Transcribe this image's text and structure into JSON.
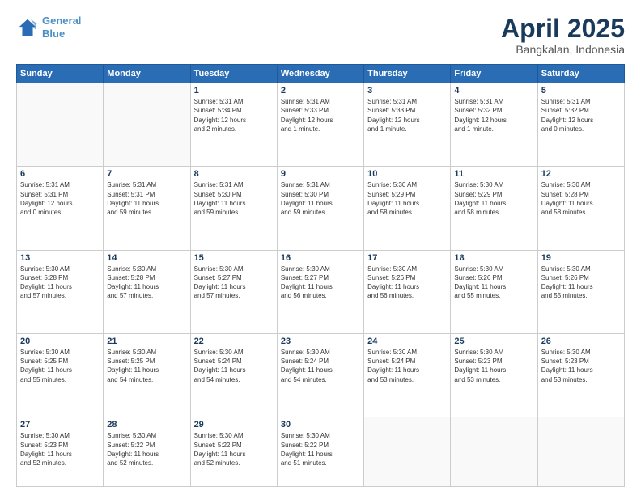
{
  "header": {
    "logo_line1": "General",
    "logo_line2": "Blue",
    "month": "April 2025",
    "location": "Bangkalan, Indonesia"
  },
  "weekdays": [
    "Sunday",
    "Monday",
    "Tuesday",
    "Wednesday",
    "Thursday",
    "Friday",
    "Saturday"
  ],
  "weeks": [
    [
      {
        "day": "",
        "info": ""
      },
      {
        "day": "",
        "info": ""
      },
      {
        "day": "1",
        "info": "Sunrise: 5:31 AM\nSunset: 5:34 PM\nDaylight: 12 hours\nand 2 minutes."
      },
      {
        "day": "2",
        "info": "Sunrise: 5:31 AM\nSunset: 5:33 PM\nDaylight: 12 hours\nand 1 minute."
      },
      {
        "day": "3",
        "info": "Sunrise: 5:31 AM\nSunset: 5:33 PM\nDaylight: 12 hours\nand 1 minute."
      },
      {
        "day": "4",
        "info": "Sunrise: 5:31 AM\nSunset: 5:32 PM\nDaylight: 12 hours\nand 1 minute."
      },
      {
        "day": "5",
        "info": "Sunrise: 5:31 AM\nSunset: 5:32 PM\nDaylight: 12 hours\nand 0 minutes."
      }
    ],
    [
      {
        "day": "6",
        "info": "Sunrise: 5:31 AM\nSunset: 5:31 PM\nDaylight: 12 hours\nand 0 minutes."
      },
      {
        "day": "7",
        "info": "Sunrise: 5:31 AM\nSunset: 5:31 PM\nDaylight: 11 hours\nand 59 minutes."
      },
      {
        "day": "8",
        "info": "Sunrise: 5:31 AM\nSunset: 5:30 PM\nDaylight: 11 hours\nand 59 minutes."
      },
      {
        "day": "9",
        "info": "Sunrise: 5:31 AM\nSunset: 5:30 PM\nDaylight: 11 hours\nand 59 minutes."
      },
      {
        "day": "10",
        "info": "Sunrise: 5:30 AM\nSunset: 5:29 PM\nDaylight: 11 hours\nand 58 minutes."
      },
      {
        "day": "11",
        "info": "Sunrise: 5:30 AM\nSunset: 5:29 PM\nDaylight: 11 hours\nand 58 minutes."
      },
      {
        "day": "12",
        "info": "Sunrise: 5:30 AM\nSunset: 5:28 PM\nDaylight: 11 hours\nand 58 minutes."
      }
    ],
    [
      {
        "day": "13",
        "info": "Sunrise: 5:30 AM\nSunset: 5:28 PM\nDaylight: 11 hours\nand 57 minutes."
      },
      {
        "day": "14",
        "info": "Sunrise: 5:30 AM\nSunset: 5:28 PM\nDaylight: 11 hours\nand 57 minutes."
      },
      {
        "day": "15",
        "info": "Sunrise: 5:30 AM\nSunset: 5:27 PM\nDaylight: 11 hours\nand 57 minutes."
      },
      {
        "day": "16",
        "info": "Sunrise: 5:30 AM\nSunset: 5:27 PM\nDaylight: 11 hours\nand 56 minutes."
      },
      {
        "day": "17",
        "info": "Sunrise: 5:30 AM\nSunset: 5:26 PM\nDaylight: 11 hours\nand 56 minutes."
      },
      {
        "day": "18",
        "info": "Sunrise: 5:30 AM\nSunset: 5:26 PM\nDaylight: 11 hours\nand 55 minutes."
      },
      {
        "day": "19",
        "info": "Sunrise: 5:30 AM\nSunset: 5:26 PM\nDaylight: 11 hours\nand 55 minutes."
      }
    ],
    [
      {
        "day": "20",
        "info": "Sunrise: 5:30 AM\nSunset: 5:25 PM\nDaylight: 11 hours\nand 55 minutes."
      },
      {
        "day": "21",
        "info": "Sunrise: 5:30 AM\nSunset: 5:25 PM\nDaylight: 11 hours\nand 54 minutes."
      },
      {
        "day": "22",
        "info": "Sunrise: 5:30 AM\nSunset: 5:24 PM\nDaylight: 11 hours\nand 54 minutes."
      },
      {
        "day": "23",
        "info": "Sunrise: 5:30 AM\nSunset: 5:24 PM\nDaylight: 11 hours\nand 54 minutes."
      },
      {
        "day": "24",
        "info": "Sunrise: 5:30 AM\nSunset: 5:24 PM\nDaylight: 11 hours\nand 53 minutes."
      },
      {
        "day": "25",
        "info": "Sunrise: 5:30 AM\nSunset: 5:23 PM\nDaylight: 11 hours\nand 53 minutes."
      },
      {
        "day": "26",
        "info": "Sunrise: 5:30 AM\nSunset: 5:23 PM\nDaylight: 11 hours\nand 53 minutes."
      }
    ],
    [
      {
        "day": "27",
        "info": "Sunrise: 5:30 AM\nSunset: 5:23 PM\nDaylight: 11 hours\nand 52 minutes."
      },
      {
        "day": "28",
        "info": "Sunrise: 5:30 AM\nSunset: 5:22 PM\nDaylight: 11 hours\nand 52 minutes."
      },
      {
        "day": "29",
        "info": "Sunrise: 5:30 AM\nSunset: 5:22 PM\nDaylight: 11 hours\nand 52 minutes."
      },
      {
        "day": "30",
        "info": "Sunrise: 5:30 AM\nSunset: 5:22 PM\nDaylight: 11 hours\nand 51 minutes."
      },
      {
        "day": "",
        "info": ""
      },
      {
        "day": "",
        "info": ""
      },
      {
        "day": "",
        "info": ""
      }
    ]
  ]
}
